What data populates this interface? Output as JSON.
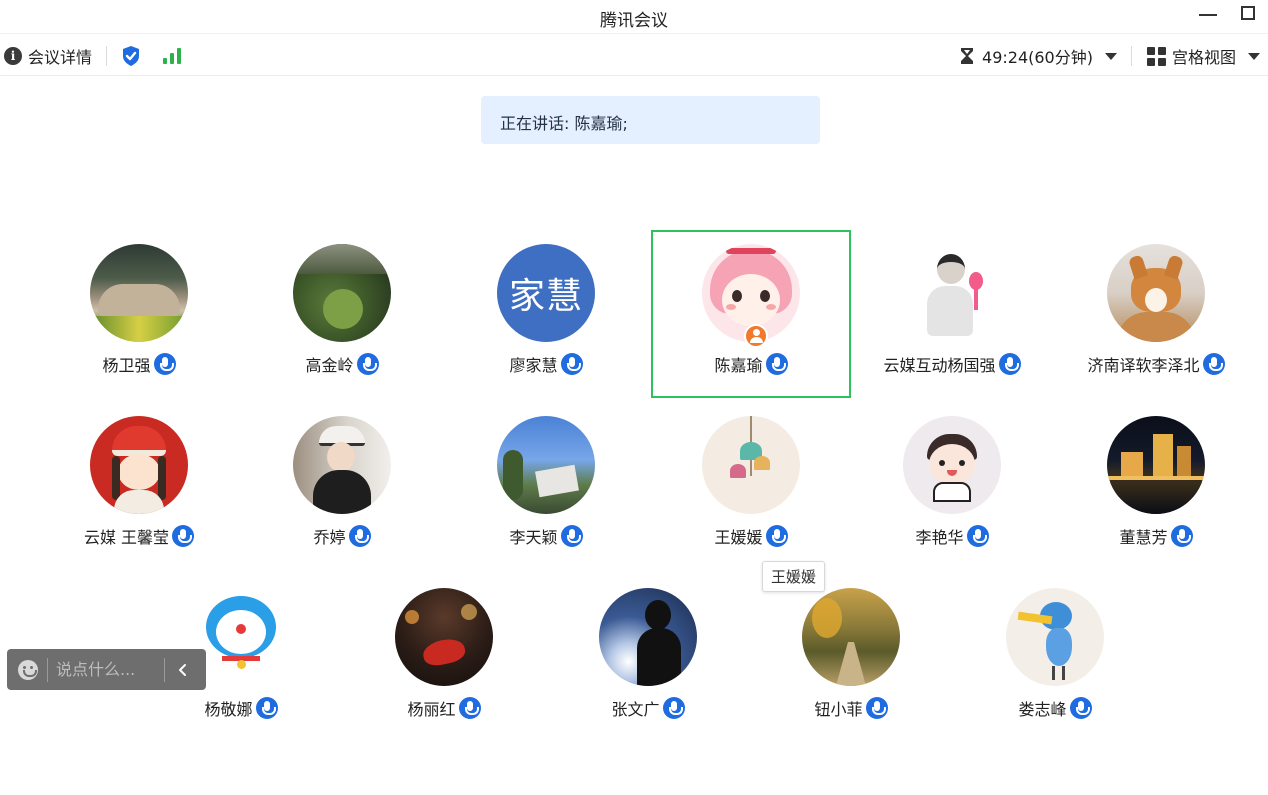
{
  "window": {
    "title": "腾讯会议"
  },
  "toolbar": {
    "details_label": "会议详情",
    "timer": "49:24(60分钟)",
    "view_label": "宫格视图"
  },
  "speaking": {
    "text": "正在讲话: 陈嘉瑜;"
  },
  "participants": [
    {
      "name": "杨卫强"
    },
    {
      "name": "高金岭"
    },
    {
      "name": "廖家慧",
      "avatar_text": "家慧"
    },
    {
      "name": "陈嘉瑜",
      "speaking": true,
      "host": true
    },
    {
      "name": "云媒互动杨国强"
    },
    {
      "name": "济南译软李泽北"
    },
    {
      "name": "云媒 王馨莹"
    },
    {
      "name": "乔婷"
    },
    {
      "name": "李天颖"
    },
    {
      "name": "王媛媛"
    },
    {
      "name": "李艳华"
    },
    {
      "name": "董慧芳"
    },
    {
      "name": "杨敬娜"
    },
    {
      "name": "杨丽红"
    },
    {
      "name": "张文广"
    },
    {
      "name": "钮小菲"
    },
    {
      "name": "娄志峰"
    }
  ],
  "tooltip": {
    "text": "王媛媛"
  },
  "chat": {
    "placeholder": "说点什么..."
  },
  "colors": {
    "accent": "#1f6ce0",
    "active_border": "#2cc45a",
    "banner_bg": "#e4efff"
  }
}
